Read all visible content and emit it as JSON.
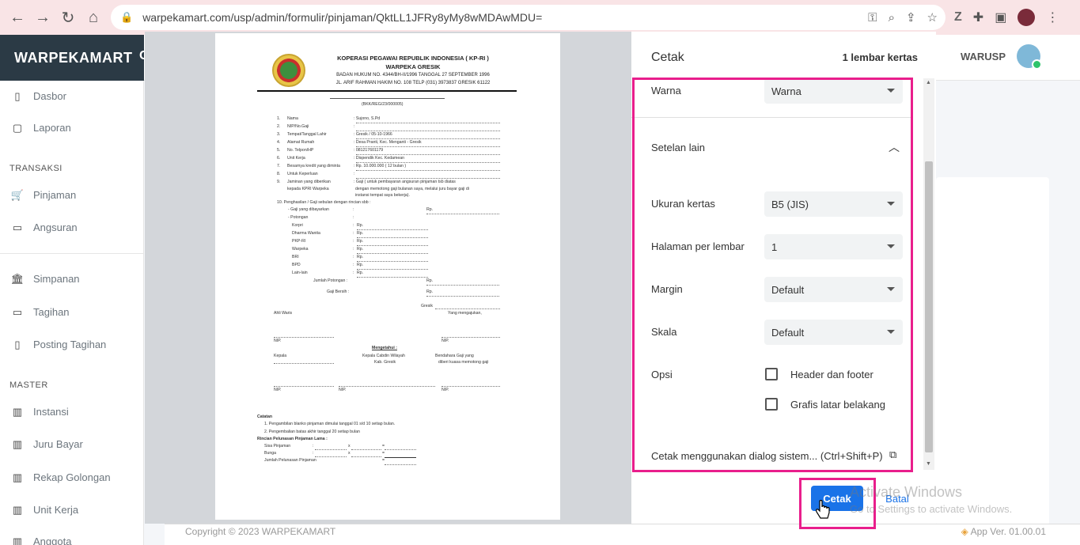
{
  "browser": {
    "url": "warpekamart.com/usp/admin/formulir/pinjaman/QktLL1JFRy8yMy8wMDAwMDU="
  },
  "app": {
    "brand": "WARPEKAMART",
    "brand_tail": "C",
    "user": "WARUSP",
    "footer_copy": "Copyright © 2023 WARPEKAMART",
    "footer_version": "App Ver. 01.00.01"
  },
  "sidebar": {
    "top": [
      {
        "label": "Dasbor"
      },
      {
        "label": "Laporan"
      }
    ],
    "transaksi_head": "TRANSAKSI",
    "transaksi": [
      {
        "label": "Pinjaman"
      },
      {
        "label": "Angsuran"
      }
    ],
    "middle": [
      {
        "label": "Simpanan"
      },
      {
        "label": "Tagihan"
      },
      {
        "label": "Posting Tagihan"
      }
    ],
    "master_head": "MASTER",
    "master": [
      {
        "label": "Instansi"
      },
      {
        "label": "Juru Bayar"
      },
      {
        "label": "Rekap Golongan"
      },
      {
        "label": "Unit Kerja"
      },
      {
        "label": "Anggota"
      }
    ]
  },
  "document": {
    "org": "KOPERASI PEGAWAI REPUBLIK INDONESIA ( KP-RI )",
    "org2": "WARPEKA GRESIK",
    "address1": "BADAN HUKUM NO. 4344/BH-II/1996 TANGGAL 27 SEPTEMBER 1996",
    "address2": "JL. ARIF RAHMAN HAKIM NO. 108 TELP (031) 3973837 GRESIK 61122",
    "ref": "(BKK/REG/23/000005)",
    "fields": [
      {
        "no": "1.",
        "label": "Nama",
        "value": ": Sujono, S.Pd"
      },
      {
        "no": "2.",
        "label": "NIP/No.Gaji",
        "value": ":"
      },
      {
        "no": "3.",
        "label": "Tempat/Tanggal Lahir",
        "value": ": Gresik / 05-10-1966"
      },
      {
        "no": "4.",
        "label": "Alamat Rumah",
        "value": ": Desa Pranti, Kec. Menganti - Gresik"
      },
      {
        "no": "5.",
        "label": "No. Telpon/HP",
        "value": ": 081217601179"
      },
      {
        "no": "6.",
        "label": "Unit Kerja",
        "value": ": Dispendik Kec. Kedamean"
      },
      {
        "no": "7.",
        "label": "Besarnya kredit yang diminta",
        "value": ":   Rp.                    10.000.000  (  12 bulan  )"
      },
      {
        "no": "8.",
        "label": "Untuk Keperluan",
        "value": ":"
      },
      {
        "no": "9.",
        "label": "Jaminan yang diberikan",
        "value": ": Gaji ( untuk pembayaran angsuran pinjaman tsb diatas"
      }
    ],
    "f9_label2": "kepada KPRI Warpeka",
    "f9_value2": "dengan memotong gaji bulanan saya, melalui juru bayar gaji di",
    "f9_value3": "instansi tempat saya bekerja).",
    "f10": "10.   Penghasilan / Gaji sebulan dengan rincian sbb :",
    "gaji_dibayarkan": "-   Gaji yang dibayarkan",
    "potongan": "-   Potongan",
    "deductions": [
      "Korpri",
      "Dharma Wanita",
      "PKP-RI",
      "Warpeka",
      "BRI",
      "BPD",
      "Lain-lain"
    ],
    "jumlah_potongan": "Jumlah Potongan   :",
    "gaji_bersih": "Gaji Bersih   :",
    "colon": ":",
    "rp": "Rp.",
    "gresik": "Gresik",
    "ahli_waris": "Ahli Waris",
    "yang_mengajukan": "Yang mengajukan,",
    "nip": "NIP.",
    "mengetahui": "Mengetahui :",
    "kepala": "Kepala",
    "kepala_cabdin": "Kepala Cabdin Wilayah",
    "kab_gresik": "Kab. Gresik",
    "bendahara": "Bendahara Gaji yang",
    "bendahara2": "diberi kuasa memotong gaji",
    "catatan": "Catatan",
    "note1": "1.   Pengambilan blanko pinjaman dimulai tanggal 01 s/d 10 setiap bulan.",
    "note2": "2.   Pengembalian batas akhir tanggal 20 setiap bulan",
    "rincian": "Rincian Pelunasan Pinjaman Lama :",
    "sisa": "Sisa Pinjaman",
    "bunga": "Bunga",
    "jumlah_pelunasan": "Jumlah Pelunasan Pinjaman",
    "x": "x",
    "eq": "="
  },
  "print_dialog": {
    "title": "Cetak",
    "pages": "1 lembar kertas",
    "warna_label": "Warna",
    "warna_value": "Warna",
    "more_settings": "Setelan lain",
    "paper_label": "Ukuran kertas",
    "paper_value": "B5 (JIS)",
    "pps_label": "Halaman per lembar",
    "pps_value": "1",
    "margin_label": "Margin",
    "margin_value": "Default",
    "scale_label": "Skala",
    "scale_value": "Default",
    "options_label": "Opsi",
    "opt_header_footer": "Header dan footer",
    "opt_background": "Grafis latar belakang",
    "system_dialog": "Cetak menggunakan dialog sistem... (Ctrl+Shift+P)",
    "print_button": "Cetak",
    "cancel_button": "Batal"
  },
  "watermark": {
    "line1": "Activate Windows",
    "line2": "Go to Settings to activate Windows."
  },
  "colors": {
    "highlight": "#e91e8c",
    "primary": "#1a73e8",
    "brand_bg": "#2b3a45"
  }
}
